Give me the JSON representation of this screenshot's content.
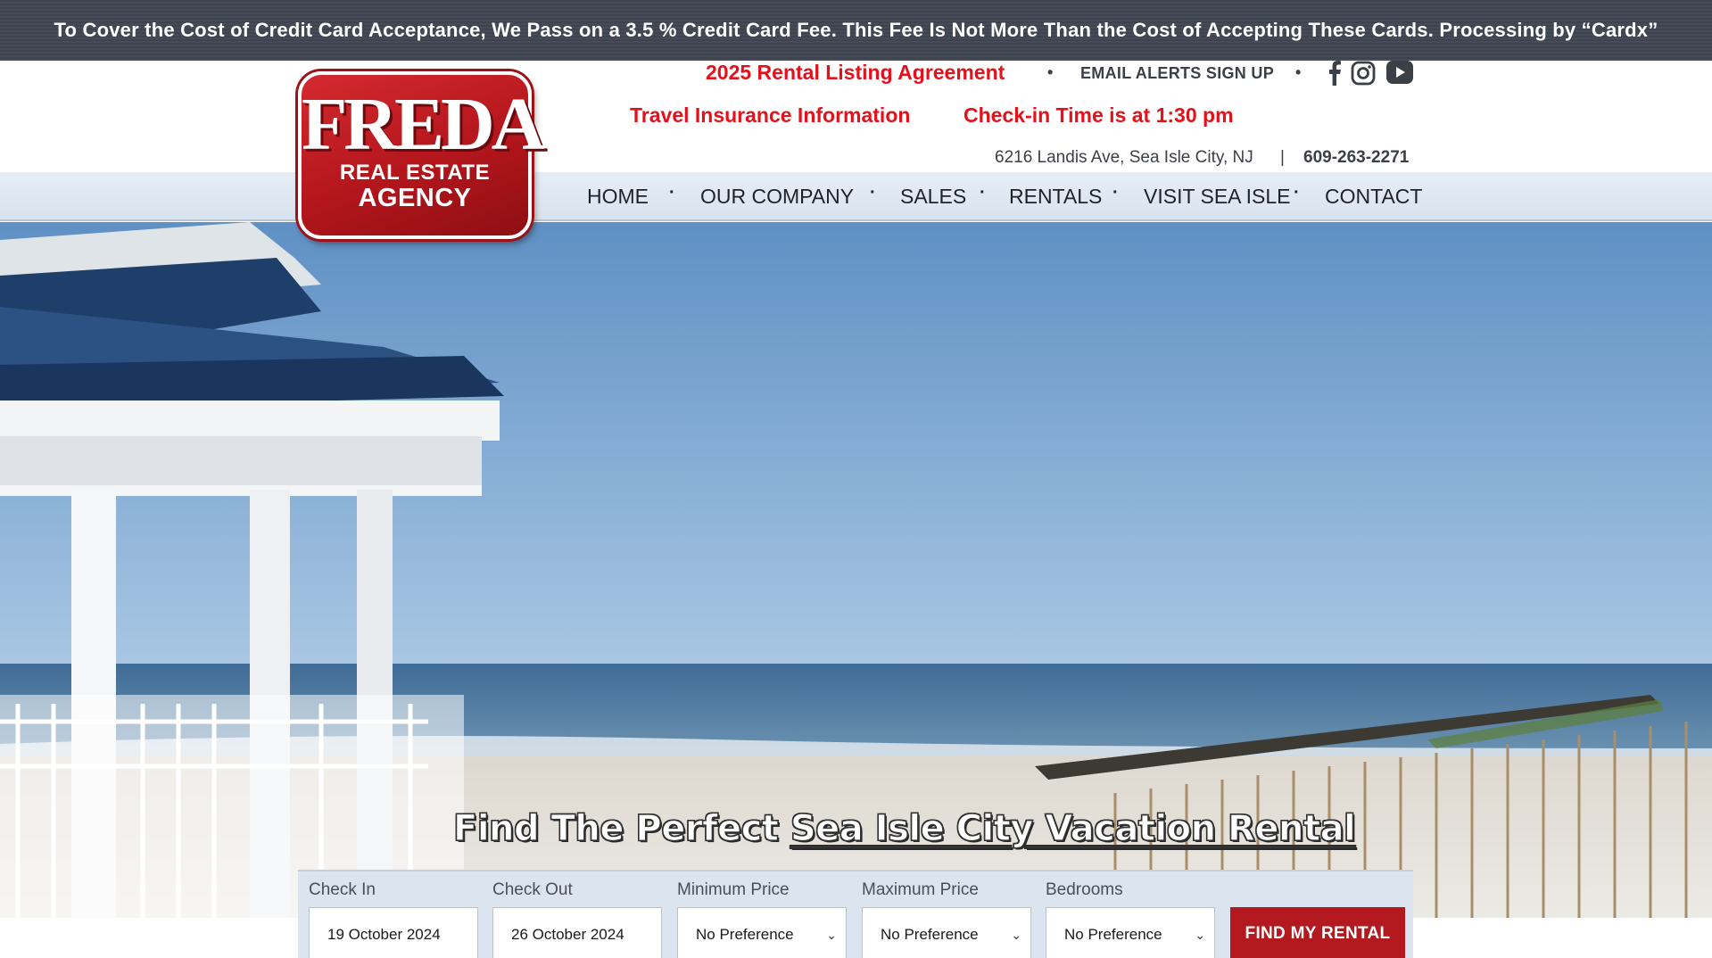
{
  "notice": "To Cover the Cost of Credit Card Acceptance, We Pass on a 3.5 % Credit Card Fee. This Fee Is Not More Than the Cost of Accepting These Cards. Processing by “Cardx”",
  "logo": {
    "main": "FREDA",
    "line1": "REAL ESTATE",
    "line2": "AGENCY"
  },
  "header": {
    "rental_listing": "2025 Rental Listing Agreement",
    "email_alerts": "EMAIL ALERTS SIGN UP",
    "travel_insurance": "Travel Insurance Information",
    "checkin_time": "Check-in Time is at 1:30 pm",
    "address": "6216 Landis Ave, Sea Isle City, NJ",
    "separator": "|",
    "phone": "609-263-2271",
    "social_icons": [
      "facebook-icon",
      "instagram-icon",
      "youtube-icon"
    ]
  },
  "nav": {
    "items": [
      "HOME",
      "OUR COMPANY",
      "SALES",
      "RENTALS",
      "VISIT SEA ISLE",
      "CONTACT"
    ]
  },
  "hero": {
    "title_part1": "Find The Perfect ",
    "title_part2": "Sea Isle City Vacation Rental"
  },
  "search": {
    "check_in_label": "Check In",
    "check_in_value": "19 October 2024",
    "check_out_label": "Check Out",
    "check_out_value": "26 October 2024",
    "min_price_label": "Minimum Price",
    "min_price_value": "No Preference",
    "max_price_label": "Maximum Price",
    "max_price_value": "No Preference",
    "bedrooms_label": "Bedrooms",
    "bedrooms_value": "No Preference",
    "button": "FIND MY RENTAL"
  },
  "colors": {
    "brand_red": "#e4111b",
    "button_red": "#b3191f",
    "notice_bg": "#414853"
  }
}
